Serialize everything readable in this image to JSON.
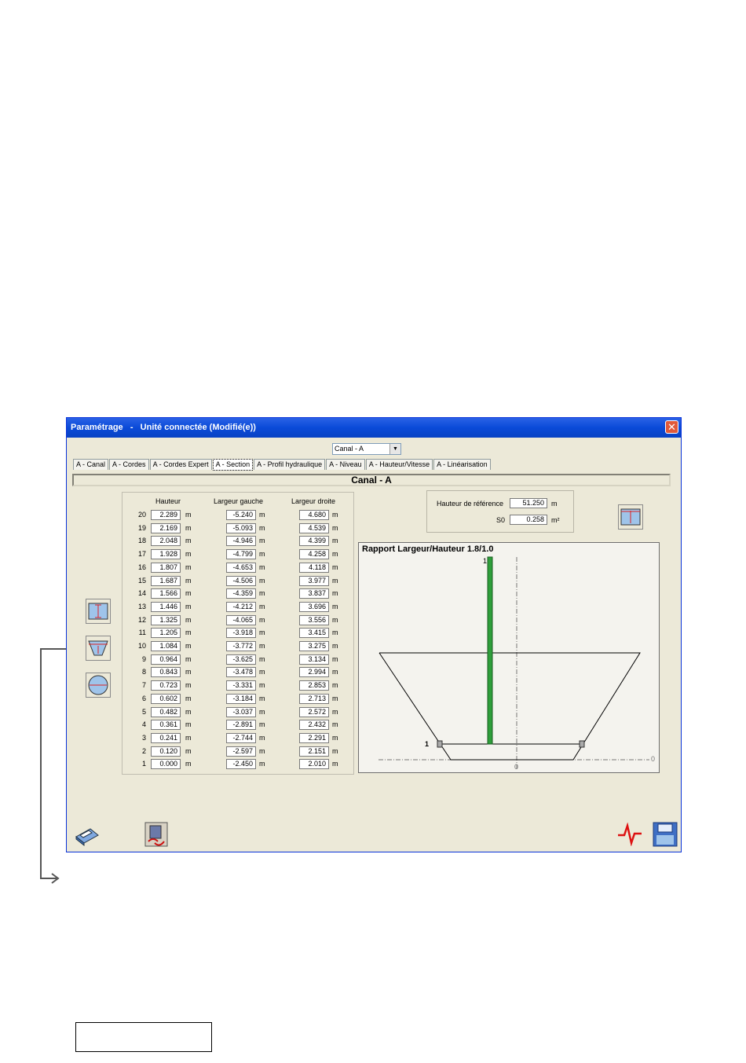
{
  "window": {
    "title": "Paramétrage   -   Unité connectée (Modifié(e))",
    "close_glyph": "✕"
  },
  "canal_select": {
    "value": "Canal - A",
    "arrow": "▼"
  },
  "tabs": [
    "A - Canal",
    "A - Cordes",
    "A - Cordes Expert",
    "A - Section",
    "A - Profil hydraulique",
    "A - Niveau",
    "A - Hauteur/Vitesse",
    "A - Linéarisation"
  ],
  "active_tab": "A - Section",
  "canal_header": "Canal - A",
  "table": {
    "headers": {
      "hauteur": "Hauteur",
      "largeur_gauche": "Largeur gauche",
      "largeur_droite": "Largeur droite"
    },
    "unit": "m",
    "rows": [
      {
        "n": "20",
        "h": "2.289",
        "lg": "-5.240",
        "ld": "4.680"
      },
      {
        "n": "19",
        "h": "2.169",
        "lg": "-5.093",
        "ld": "4.539"
      },
      {
        "n": "18",
        "h": "2.048",
        "lg": "-4.946",
        "ld": "4.399"
      },
      {
        "n": "17",
        "h": "1.928",
        "lg": "-4.799",
        "ld": "4.258"
      },
      {
        "n": "16",
        "h": "1.807",
        "lg": "-4.653",
        "ld": "4.118"
      },
      {
        "n": "15",
        "h": "1.687",
        "lg": "-4.506",
        "ld": "3.977"
      },
      {
        "n": "14",
        "h": "1.566",
        "lg": "-4.359",
        "ld": "3.837"
      },
      {
        "n": "13",
        "h": "1.446",
        "lg": "-4.212",
        "ld": "3.696"
      },
      {
        "n": "12",
        "h": "1.325",
        "lg": "-4.065",
        "ld": "3.556"
      },
      {
        "n": "11",
        "h": "1.205",
        "lg": "-3.918",
        "ld": "3.415"
      },
      {
        "n": "10",
        "h": "1.084",
        "lg": "-3.772",
        "ld": "3.275"
      },
      {
        "n": "9",
        "h": "0.964",
        "lg": "-3.625",
        "ld": "3.134"
      },
      {
        "n": "8",
        "h": "0.843",
        "lg": "-3.478",
        "ld": "2.994"
      },
      {
        "n": "7",
        "h": "0.723",
        "lg": "-3.331",
        "ld": "2.853"
      },
      {
        "n": "6",
        "h": "0.602",
        "lg": "-3.184",
        "ld": "2.713"
      },
      {
        "n": "5",
        "h": "0.482",
        "lg": "-3.037",
        "ld": "2.572"
      },
      {
        "n": "4",
        "h": "0.361",
        "lg": "-2.891",
        "ld": "2.432"
      },
      {
        "n": "3",
        "h": "0.241",
        "lg": "-2.744",
        "ld": "2.291"
      },
      {
        "n": "2",
        "h": "0.120",
        "lg": "-2.597",
        "ld": "2.151"
      },
      {
        "n": "1",
        "h": "0.000",
        "lg": "-2.450",
        "ld": "2.010"
      }
    ]
  },
  "reference": {
    "hauteur_label": "Hauteur de référence",
    "hauteur_value": "51.250",
    "hauteur_unit": "m",
    "s0_label": "S0",
    "s0_value": "0.258",
    "s0_unit": "m²"
  },
  "chart": {
    "title": "Rapport Largeur/Hauteur 1.8/1.0",
    "bar_label": "1",
    "level_label": "1",
    "x_zero": "0",
    "right_zero": "0",
    "colors": {
      "bar": "#2e9e3a",
      "lines": "#000000"
    }
  },
  "icons": {
    "shape_rectangle": "rectangle-section-icon",
    "shape_trapezoid": "trapezoid-section-icon",
    "shape_circle": "circle-section-icon",
    "print": "printer-icon",
    "transfer": "transfer-icon",
    "signal": "signal-icon",
    "save": "save-icon"
  },
  "page_label_box": ""
}
